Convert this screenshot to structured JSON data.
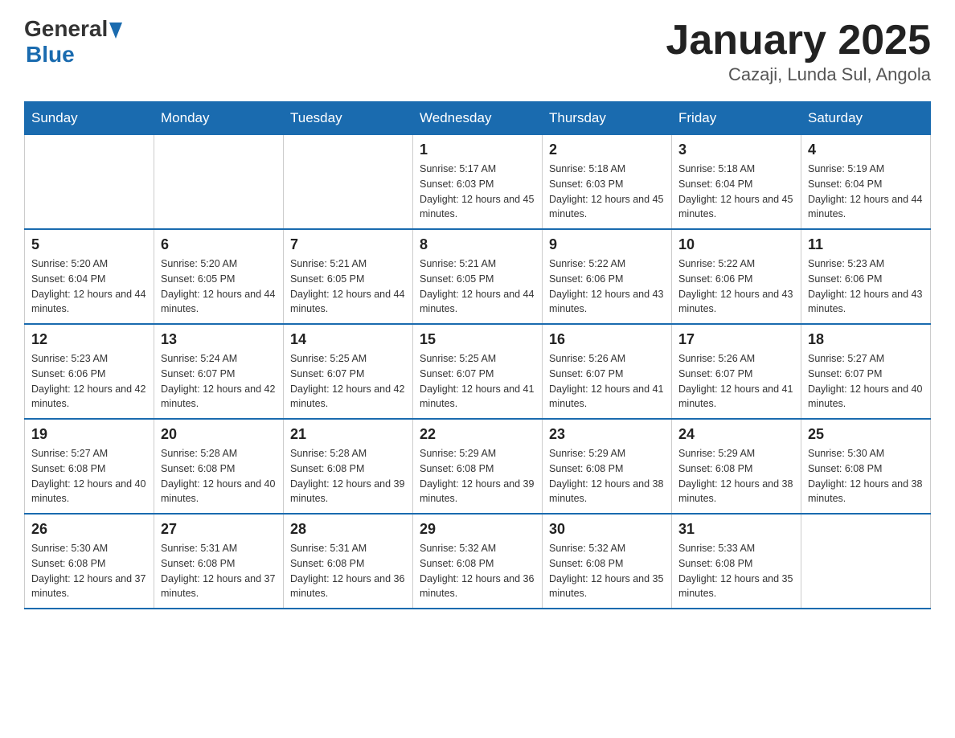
{
  "logo": {
    "general": "General",
    "blue": "Blue"
  },
  "title": "January 2025",
  "subtitle": "Cazaji, Lunda Sul, Angola",
  "headers": [
    "Sunday",
    "Monday",
    "Tuesday",
    "Wednesday",
    "Thursday",
    "Friday",
    "Saturday"
  ],
  "weeks": [
    [
      {
        "day": "",
        "info": ""
      },
      {
        "day": "",
        "info": ""
      },
      {
        "day": "",
        "info": ""
      },
      {
        "day": "1",
        "info": "Sunrise: 5:17 AM\nSunset: 6:03 PM\nDaylight: 12 hours and 45 minutes."
      },
      {
        "day": "2",
        "info": "Sunrise: 5:18 AM\nSunset: 6:03 PM\nDaylight: 12 hours and 45 minutes."
      },
      {
        "day": "3",
        "info": "Sunrise: 5:18 AM\nSunset: 6:04 PM\nDaylight: 12 hours and 45 minutes."
      },
      {
        "day": "4",
        "info": "Sunrise: 5:19 AM\nSunset: 6:04 PM\nDaylight: 12 hours and 44 minutes."
      }
    ],
    [
      {
        "day": "5",
        "info": "Sunrise: 5:20 AM\nSunset: 6:04 PM\nDaylight: 12 hours and 44 minutes."
      },
      {
        "day": "6",
        "info": "Sunrise: 5:20 AM\nSunset: 6:05 PM\nDaylight: 12 hours and 44 minutes."
      },
      {
        "day": "7",
        "info": "Sunrise: 5:21 AM\nSunset: 6:05 PM\nDaylight: 12 hours and 44 minutes."
      },
      {
        "day": "8",
        "info": "Sunrise: 5:21 AM\nSunset: 6:05 PM\nDaylight: 12 hours and 44 minutes."
      },
      {
        "day": "9",
        "info": "Sunrise: 5:22 AM\nSunset: 6:06 PM\nDaylight: 12 hours and 43 minutes."
      },
      {
        "day": "10",
        "info": "Sunrise: 5:22 AM\nSunset: 6:06 PM\nDaylight: 12 hours and 43 minutes."
      },
      {
        "day": "11",
        "info": "Sunrise: 5:23 AM\nSunset: 6:06 PM\nDaylight: 12 hours and 43 minutes."
      }
    ],
    [
      {
        "day": "12",
        "info": "Sunrise: 5:23 AM\nSunset: 6:06 PM\nDaylight: 12 hours and 42 minutes."
      },
      {
        "day": "13",
        "info": "Sunrise: 5:24 AM\nSunset: 6:07 PM\nDaylight: 12 hours and 42 minutes."
      },
      {
        "day": "14",
        "info": "Sunrise: 5:25 AM\nSunset: 6:07 PM\nDaylight: 12 hours and 42 minutes."
      },
      {
        "day": "15",
        "info": "Sunrise: 5:25 AM\nSunset: 6:07 PM\nDaylight: 12 hours and 41 minutes."
      },
      {
        "day": "16",
        "info": "Sunrise: 5:26 AM\nSunset: 6:07 PM\nDaylight: 12 hours and 41 minutes."
      },
      {
        "day": "17",
        "info": "Sunrise: 5:26 AM\nSunset: 6:07 PM\nDaylight: 12 hours and 41 minutes."
      },
      {
        "day": "18",
        "info": "Sunrise: 5:27 AM\nSunset: 6:07 PM\nDaylight: 12 hours and 40 minutes."
      }
    ],
    [
      {
        "day": "19",
        "info": "Sunrise: 5:27 AM\nSunset: 6:08 PM\nDaylight: 12 hours and 40 minutes."
      },
      {
        "day": "20",
        "info": "Sunrise: 5:28 AM\nSunset: 6:08 PM\nDaylight: 12 hours and 40 minutes."
      },
      {
        "day": "21",
        "info": "Sunrise: 5:28 AM\nSunset: 6:08 PM\nDaylight: 12 hours and 39 minutes."
      },
      {
        "day": "22",
        "info": "Sunrise: 5:29 AM\nSunset: 6:08 PM\nDaylight: 12 hours and 39 minutes."
      },
      {
        "day": "23",
        "info": "Sunrise: 5:29 AM\nSunset: 6:08 PM\nDaylight: 12 hours and 38 minutes."
      },
      {
        "day": "24",
        "info": "Sunrise: 5:29 AM\nSunset: 6:08 PM\nDaylight: 12 hours and 38 minutes."
      },
      {
        "day": "25",
        "info": "Sunrise: 5:30 AM\nSunset: 6:08 PM\nDaylight: 12 hours and 38 minutes."
      }
    ],
    [
      {
        "day": "26",
        "info": "Sunrise: 5:30 AM\nSunset: 6:08 PM\nDaylight: 12 hours and 37 minutes."
      },
      {
        "day": "27",
        "info": "Sunrise: 5:31 AM\nSunset: 6:08 PM\nDaylight: 12 hours and 37 minutes."
      },
      {
        "day": "28",
        "info": "Sunrise: 5:31 AM\nSunset: 6:08 PM\nDaylight: 12 hours and 36 minutes."
      },
      {
        "day": "29",
        "info": "Sunrise: 5:32 AM\nSunset: 6:08 PM\nDaylight: 12 hours and 36 minutes."
      },
      {
        "day": "30",
        "info": "Sunrise: 5:32 AM\nSunset: 6:08 PM\nDaylight: 12 hours and 35 minutes."
      },
      {
        "day": "31",
        "info": "Sunrise: 5:33 AM\nSunset: 6:08 PM\nDaylight: 12 hours and 35 minutes."
      },
      {
        "day": "",
        "info": ""
      }
    ]
  ]
}
